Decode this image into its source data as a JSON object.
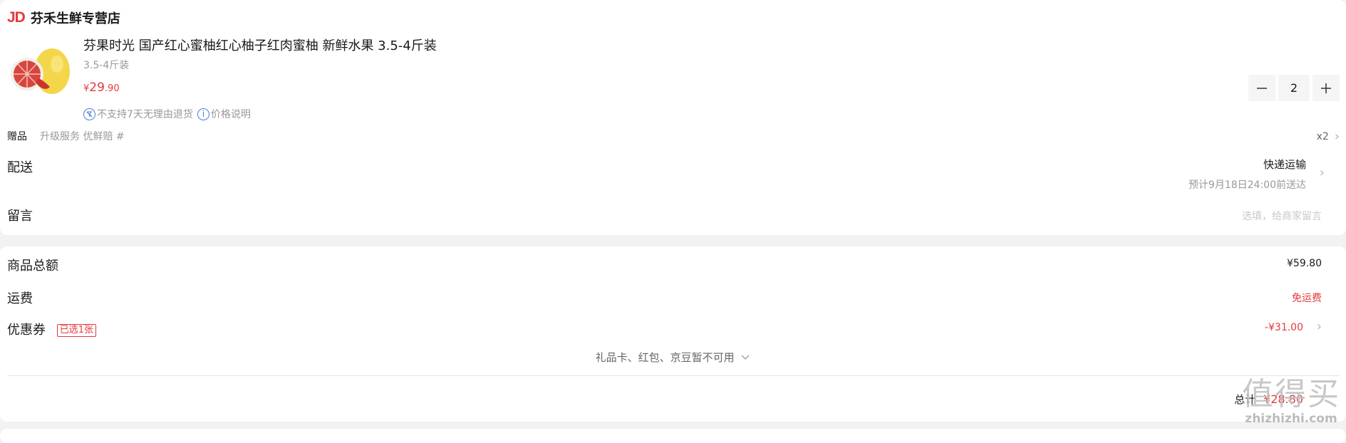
{
  "store": {
    "logo": "JD",
    "name": "芬禾生鲜专营店"
  },
  "product": {
    "title": "芬果时光 国产红心蜜柚红心柚子红肉蜜柚 新鲜水果 3.5-4斤装",
    "spec": "3.5-4斤装",
    "price_symbol": "¥",
    "price_int": "29",
    "price_dec": ".90",
    "quantity": "2",
    "notes": [
      "不支持7天无理由退货",
      "价格说明"
    ]
  },
  "gift": {
    "label": "赠品",
    "text": "升级服务 优鲜赔 #",
    "count": "x2"
  },
  "delivery": {
    "label": "配送",
    "method": "快递运输",
    "eta": "预计9月18日24:00前送达"
  },
  "message": {
    "label": "留言",
    "placeholder": "选填，给商家留言"
  },
  "summary": {
    "goods_total_label": "商品总额",
    "goods_total": "¥59.80",
    "shipping_label": "运费",
    "shipping": "免运费",
    "coupon_label": "优惠券",
    "coupon_badge": "已选1张",
    "coupon_value": "-¥31.00",
    "unavailable": "礼品卡、红包、京豆暂不可用",
    "total_label": "总计",
    "total": "¥28.80"
  },
  "watermark": {
    "big": "值得买",
    "small": "zhizhizhi.com"
  },
  "colors": {
    "accent": "#e4393c",
    "info": "#4a7fd0"
  }
}
